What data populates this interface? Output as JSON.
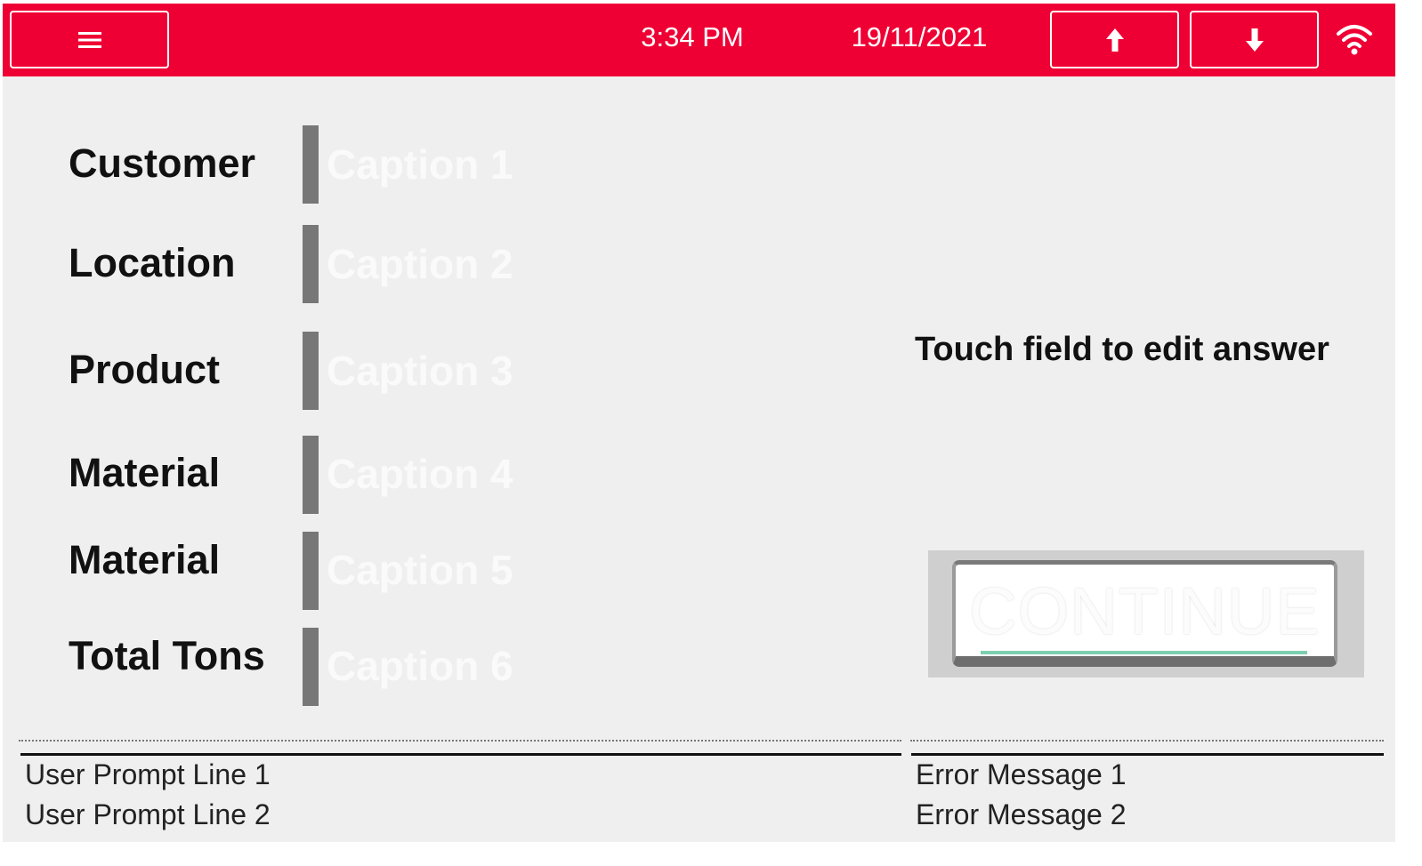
{
  "header": {
    "time": "3:34 PM",
    "date": "19/11/2021",
    "menu_icon": "hamburger-menu-icon",
    "up_icon": "arrow-up-icon",
    "down_icon": "arrow-down-icon",
    "wifi_icon": "wifi-icon",
    "bar_color": "#ee0034"
  },
  "fields": [
    {
      "label": "Customer",
      "caption": "Caption 1"
    },
    {
      "label": "Location",
      "caption": "Caption 2"
    },
    {
      "label": "Product",
      "caption": "Caption 3"
    },
    {
      "label": "Material",
      "caption": "Caption 4"
    },
    {
      "label": "Material",
      "caption": "Caption 5"
    },
    {
      "label": "Total Tons",
      "caption": "Caption 6"
    }
  ],
  "hint": "Touch field to edit answer",
  "continue_label": "CONTINUE",
  "footer": {
    "prompt_line_1": "User Prompt Line 1",
    "prompt_line_2": "User Prompt Line 2",
    "error_1": "Error Message 1",
    "error_2": "Error Message 2"
  }
}
